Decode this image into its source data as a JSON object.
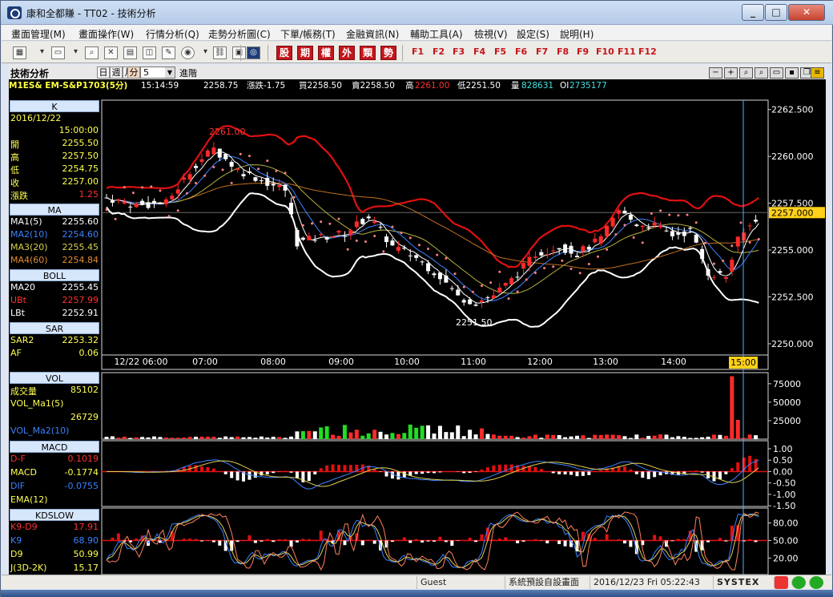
{
  "window": {
    "title": "康和全都賺 - TT02 - 技術分析",
    "min_glyph": "_",
    "max_glyph": "□",
    "close_glyph": "✕"
  },
  "menu": [
    "畫面管理(M)",
    "畫面操作(W)",
    "行情分析(Q)",
    "走勢分析圖(C)",
    "下單/帳務(T)",
    "金融資訊(N)",
    "輔助工具(A)",
    "檢視(V)",
    "設定(S)",
    "說明(H)"
  ],
  "toolbar": {
    "cn_buttons": [
      "股",
      "期",
      "權",
      "外",
      "類",
      "勢"
    ],
    "f_keys": [
      "F1",
      "F2",
      "F3",
      "F4",
      "F5",
      "F6",
      "F7",
      "F8",
      "F9",
      "F10",
      "F11",
      "F12"
    ]
  },
  "chart_header": {
    "label": "技術分析",
    "periods": [
      "日",
      "週",
      "月",
      "分"
    ],
    "active_period": "分",
    "interval": "5",
    "advanced": "進階"
  },
  "quote": {
    "symbol": "M1ES& EM-S&P1703(5分)",
    "time": "15:14:59",
    "price": "2258.75",
    "change": "漲跌-1.75",
    "bid": "買2258.50",
    "ask": "賣2258.50",
    "high_label": "高",
    "high": "2261.00",
    "low": "低2251.50",
    "volume_label": "量",
    "volume": "828631",
    "oi_label": "OI",
    "oi": "2735177"
  },
  "left": {
    "k_title": "K",
    "date": "2016/12/22",
    "time": "15:00:00",
    "ohlc": [
      {
        "label": "開",
        "value": "2255.50"
      },
      {
        "label": "高",
        "value": "2257.50"
      },
      {
        "label": "低",
        "value": "2254.75"
      },
      {
        "label": "收",
        "value": "2257.00"
      },
      {
        "label": "漲跌",
        "value": "1.25"
      }
    ],
    "ma_title": "MA",
    "ma": [
      {
        "label": "MA1(5)",
        "value": "2255.60"
      },
      {
        "label": "MA2(10)",
        "value": "2254.60"
      },
      {
        "label": "MA3(20)",
        "value": "2255.45"
      },
      {
        "label": "MA4(60)",
        "value": "2254.84"
      }
    ],
    "boll_title": "BOLL",
    "boll": [
      {
        "label": "MA20",
        "value": "2255.45"
      },
      {
        "label": "UBt",
        "value": "2257.99"
      },
      {
        "label": "LBt",
        "value": "2252.91"
      }
    ],
    "sar_title": "SAR",
    "sar": [
      {
        "label": "SAR2",
        "value": "2253.32"
      },
      {
        "label": "AF",
        "value": "0.06"
      }
    ],
    "vol_title": "VOL",
    "vol": [
      {
        "label": "成交量",
        "value": "85102"
      },
      {
        "label": "VOL_Ma1(5)",
        "value": ""
      },
      {
        "label": "",
        "value": "26729"
      },
      {
        "label": "VOL_Ma2(10)",
        "value": ""
      }
    ],
    "macd_title": "MACD",
    "macd": [
      {
        "label": "D-F",
        "value": "0.1019"
      },
      {
        "label": "MACD",
        "value": "-0.1774"
      },
      {
        "label": "DIF",
        "value": "-0.0755"
      },
      {
        "label": "EMA(12)",
        "value": ""
      }
    ],
    "kd_title": "KDSLOW",
    "kd": [
      {
        "label": "K9-D9",
        "value": "17.91"
      },
      {
        "label": "K9",
        "value": "68.90"
      },
      {
        "label": "D9",
        "value": "50.99"
      },
      {
        "label": "J(3D-2K)",
        "value": "15.17"
      }
    ]
  },
  "price_axis": [
    "2262.500",
    "2260.000",
    "2257.500",
    "2255.000",
    "2252.500",
    "2250.000"
  ],
  "current_price_tag": "2257.000",
  "time_axis": [
    "12/22 06:00",
    "07:00",
    "08:00",
    "09:00",
    "10:00",
    "11:00",
    "12:00",
    "13:00",
    "14:00"
  ],
  "time_cursor": "15:00",
  "annotations": {
    "high": "2261.00",
    "low": "2251.50"
  },
  "vol_axis": [
    "75000",
    "50000",
    "25000"
  ],
  "macd_axis": [
    "1.00",
    "0.50",
    "0.00",
    "-0.50",
    "-1.00",
    "-1.50"
  ],
  "kd_axis": [
    "80.00",
    "50.00",
    "20.00"
  ],
  "status": {
    "user": "Guest",
    "layout": "系統預設自設畫面",
    "datetime": "2016/12/23 Fri 05:22:43",
    "brand": "SYSTEX"
  },
  "colors": {
    "up": "#ff2a2a",
    "down": "#ffffff",
    "boll_up": "#e01010",
    "boll_low": "#ffffff",
    "sar": "#ff8080",
    "ma1": "#ffffff",
    "ma2": "#3b82ff",
    "ma3": "#b8b040",
    "ma4": "#c07020",
    "grid": "#1f3a5a"
  }
}
